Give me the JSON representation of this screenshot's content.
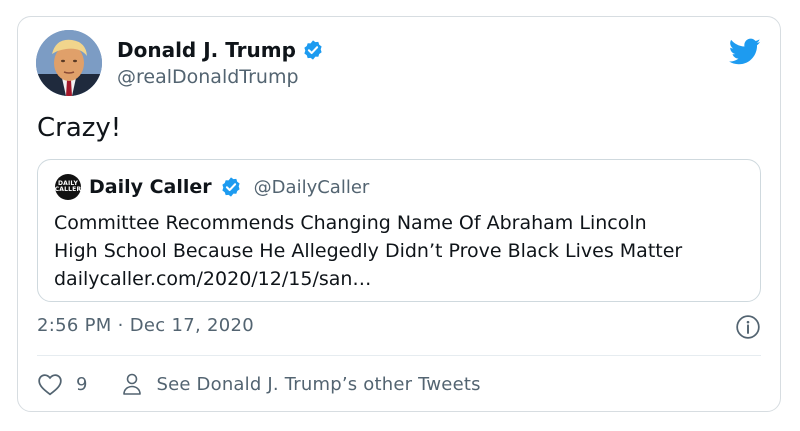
{
  "colors": {
    "twitter_blue": "#1d9bf0",
    "text_primary": "#0f1419",
    "text_secondary": "#536471",
    "border": "#cfd9de"
  },
  "tweet": {
    "author": {
      "name": "Donald J. Trump",
      "handle": "@realDonaldTrump",
      "verified": true,
      "avatar_icon": "profile-photo"
    },
    "text": "Crazy!",
    "quoted": {
      "name": "Daily Caller",
      "handle": "@DailyCaller",
      "verified": true,
      "logo_text": [
        "DAILY",
        "CALLER"
      ],
      "body_lines": [
        "Committee Recommends Changing Name Of Abraham Lincoln",
        "High School Because He Allegedly Didn’t Prove Black Lives Matter",
        "dailycaller.com/2020/12/15/san…"
      ]
    },
    "timestamp": "2:56 PM · Dec 17, 2020",
    "likes": "9",
    "other_tweets_label": "See Donald J. Trump’s other Tweets"
  },
  "icons": {
    "brand": "twitter-bird-icon",
    "info": "info-icon",
    "like": "heart-icon",
    "profile": "person-icon"
  }
}
